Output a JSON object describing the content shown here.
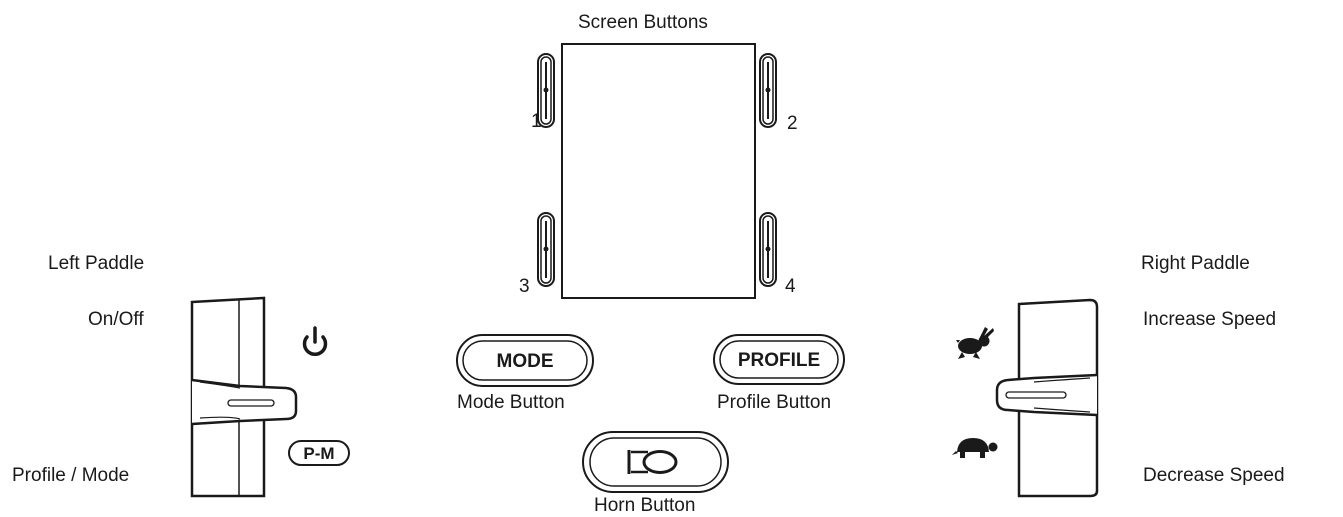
{
  "title": "Screen Buttons",
  "screen_buttons": {
    "button_1": "1",
    "button_2": "2",
    "button_3": "3",
    "button_4": "4"
  },
  "left_paddle": {
    "heading": "Left Paddle",
    "top_label": "On/Off",
    "bottom_label": "Profile / Mode",
    "top_icon": "power-icon",
    "bottom_badge": "P-M"
  },
  "right_paddle": {
    "heading": "Right Paddle",
    "top_label": "Increase Speed",
    "bottom_label": "Decrease Speed",
    "top_icon": "rabbit-icon",
    "bottom_icon": "turtle-icon"
  },
  "mode_button": {
    "text": "MODE",
    "caption": "Mode Button"
  },
  "profile_button": {
    "text": "PROFILE",
    "caption": "Profile Button"
  },
  "horn_button": {
    "icon": "horn-icon",
    "caption": "Horn Button"
  },
  "colors": {
    "ink": "#1a1a1a",
    "background": "#ffffff"
  }
}
